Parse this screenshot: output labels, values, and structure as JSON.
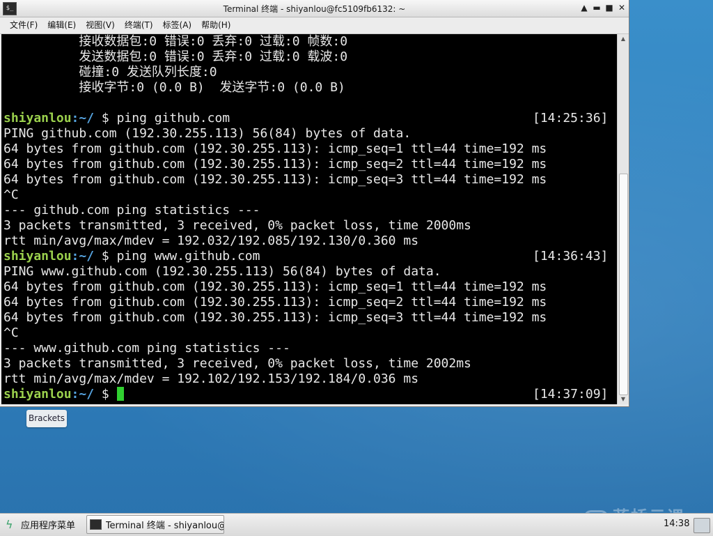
{
  "window": {
    "title": "Terminal 终端 - shiyanlou@fc5109fb6132: ~",
    "app_icon": "terminal-icon",
    "controls": [
      "▲",
      "▬",
      "■",
      "✕"
    ]
  },
  "menubar": {
    "items": [
      "文件(F)",
      "编辑(E)",
      "视图(V)",
      "终端(T)",
      "标签(A)",
      "帮助(H)"
    ]
  },
  "terminal": {
    "lines": [
      "          接收数据包:0 错误:0 丢弃:0 过载:0 帧数:0",
      "          发送数据包:0 错误:0 丢弃:0 过载:0 载波:0",
      "          碰撞:0 发送队列长度:0",
      "          接收字节:0 (0.0 B)  发送字节:0 (0.0 B)",
      "",
      "",
      "PING github.com (192.30.255.113) 56(84) bytes of data.",
      "64 bytes from github.com (192.30.255.113): icmp_seq=1 ttl=44 time=192 ms",
      "64 bytes from github.com (192.30.255.113): icmp_seq=2 ttl=44 time=192 ms",
      "64 bytes from github.com (192.30.255.113): icmp_seq=3 ttl=44 time=192 ms",
      "^C",
      "--- github.com ping statistics ---",
      "3 packets transmitted, 3 received, 0% packet loss, time 2000ms",
      "rtt min/avg/max/mdev = 192.032/192.085/192.130/0.360 ms",
      "",
      "PING www.github.com (192.30.255.113) 56(84) bytes of data.",
      "64 bytes from github.com (192.30.255.113): icmp_seq=1 ttl=44 time=192 ms",
      "64 bytes from github.com (192.30.255.113): icmp_seq=2 ttl=44 time=192 ms",
      "64 bytes from github.com (192.30.255.113): icmp_seq=3 ttl=44 time=192 ms",
      "^C",
      "--- www.github.com ping statistics ---",
      "3 packets transmitted, 3 received, 0% packet loss, time 2002ms",
      "rtt min/avg/max/mdev = 192.102/192.153/192.184/0.036 ms",
      ""
    ],
    "prompts": [
      {
        "user": "shiyanlou",
        "path": ":~/",
        "cmd": " $ ping github.com",
        "time": "[14:25:36]"
      },
      {
        "user": "shiyanlou",
        "path": ":~/",
        "cmd": " $ ping www.github.com",
        "time": "[14:36:43]"
      },
      {
        "user": "shiyanlou",
        "path": ":~/",
        "cmd": " $ ",
        "time": "[14:37:09]"
      }
    ]
  },
  "desktop": {
    "icon_label": "Brackets"
  },
  "taskbar": {
    "start_label": "应用程序菜单",
    "task_label": "Terminal 终端 - shiyanlou@f···",
    "clock": "14:38"
  },
  "watermark": {
    "text": "蓝桥云课"
  }
}
